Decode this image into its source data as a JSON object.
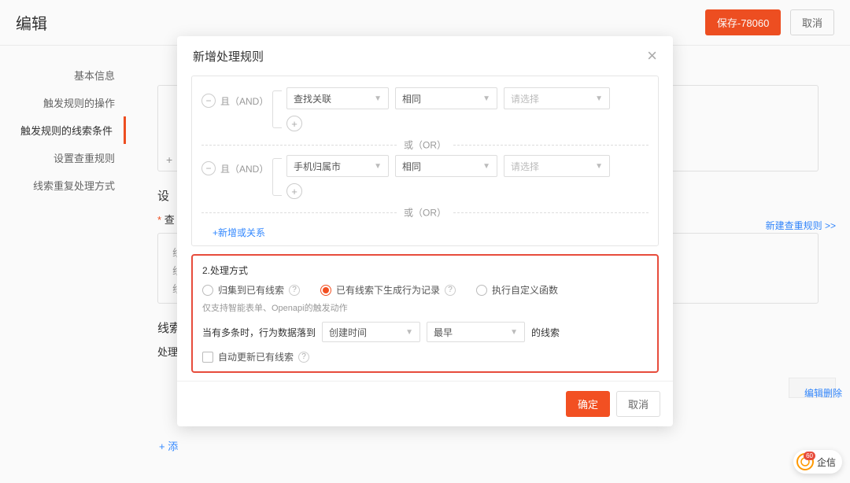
{
  "page": {
    "title": "编辑",
    "save_button": "保存-78060",
    "cancel_button": "取消"
  },
  "sidebar": {
    "items": [
      {
        "label": "基本信息"
      },
      {
        "label": "触发规则的操作"
      },
      {
        "label": "触发规则的线索条件"
      },
      {
        "label": "设置查重规则"
      },
      {
        "label": "线索重复处理方式"
      }
    ]
  },
  "bg": {
    "section_prefix": "设",
    "req_label": "* 查",
    "new_rule_link": "新建查重规则 >>",
    "row1": "线",
    "row2": "线",
    "row3": "线",
    "sec2": "线索",
    "sec3": "处理",
    "edit": "编辑",
    "delete": "删除",
    "add_link": "+ 添"
  },
  "modal": {
    "title": "新增处理规则",
    "and_label": "且（AND）",
    "or_label": "或（OR）",
    "rule1": {
      "field": "查找关联",
      "op": "相同",
      "value": "请选择"
    },
    "rule2": {
      "field": "手机归属市",
      "op": "相同",
      "value": "请选择"
    },
    "add_or": "+新增或关系",
    "section2_title": "2.处理方式",
    "radios": {
      "merge": "归集到已有线索",
      "record": "已有线索下生成行为记录",
      "custom": "执行自定义函数"
    },
    "hint": "仅支持智能表单、Openapi的触发动作",
    "multi_label": "当有多条时，行为数据落到",
    "multi_field": "创建时间",
    "multi_order": "最早",
    "multi_suffix": "的线索",
    "auto_update": "自动更新已有线索",
    "confirm": "确定",
    "cancel": "取消"
  },
  "float": {
    "count": "60",
    "label": "企信"
  }
}
